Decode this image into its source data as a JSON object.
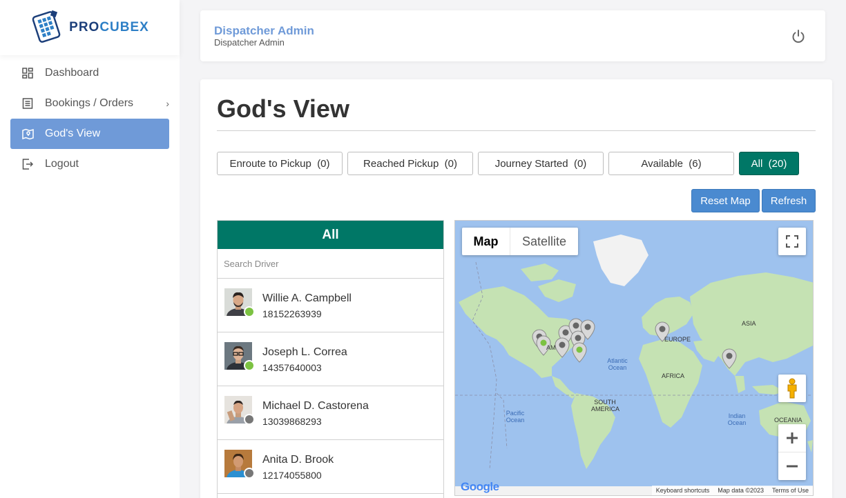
{
  "brand": {
    "name_part1": "PRO",
    "name_part2": "CUBEX"
  },
  "sidebar": {
    "items": [
      {
        "label": "Dashboard"
      },
      {
        "label": "Bookings / Orders"
      },
      {
        "label": "God's View"
      },
      {
        "label": "Logout"
      }
    ]
  },
  "header": {
    "title": "Dispatcher Admin",
    "subtitle": "Dispatcher Admin"
  },
  "page": {
    "title": "God's View"
  },
  "filters": [
    {
      "label": "Enroute to Pickup  (0)"
    },
    {
      "label": "Reached Pickup  (0)"
    },
    {
      "label": "Journey Started  (0)"
    },
    {
      "label": "Available  (6)"
    },
    {
      "label": "All  (20)"
    }
  ],
  "actions": {
    "reset_map": "Reset Map",
    "refresh": "Refresh"
  },
  "driver_panel": {
    "title": "All",
    "search_placeholder": "Search Driver",
    "drivers": [
      {
        "name": "Willie A. Campbell",
        "phone": "18152263939",
        "status": "online"
      },
      {
        "name": "Joseph L. Correa",
        "phone": "14357640003",
        "status": "online"
      },
      {
        "name": "Michael D. Castorena",
        "phone": "13039868293",
        "status": "offline"
      },
      {
        "name": "Anita D. Brook",
        "phone": "12174055800",
        "status": "offline"
      }
    ]
  },
  "map": {
    "type_map": "Map",
    "type_satellite": "Satellite",
    "labels": {
      "asia": "ASIA",
      "europe": "EUROPE",
      "africa": "AFRICA",
      "south_america": "SOUTH AMERICA",
      "oceania": "OCEANIA",
      "atlantic": "Atlantic Ocean",
      "pacific": "Pacific Ocean",
      "indian": "Indian Ocean",
      "north_america_fragment": "AM"
    },
    "footer": {
      "shortcuts": "Keyboard shortcuts",
      "map_data": "Map data ©2023",
      "terms": "Terms of Use"
    },
    "google": "Google"
  },
  "colors": {
    "accent_green": "#007766",
    "sidebar_active": "#6f9ad8",
    "button_blue": "#4a8ad0",
    "online": "#7cc242",
    "offline": "#777777"
  }
}
